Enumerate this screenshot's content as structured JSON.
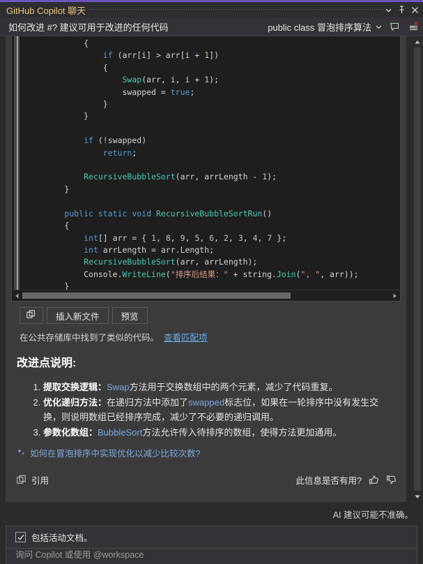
{
  "window": {
    "title": "GitHub Copilot 聊天",
    "accent_color": "#6a55bd",
    "title_color": "#e8c77b",
    "dropdown_icon": "chevron-down-icon",
    "pin_icon": "pin-icon",
    "close_icon": "close-icon"
  },
  "header": {
    "prompt": "如何改进 #? 建议可用于改进的任何代码",
    "context": "public class 冒泡排序算法",
    "context_dropdown_icon": "chevron-down-icon",
    "new_chat_icon": "new-chat-icon",
    "clear_chat_icon": "clear-chat-icon"
  },
  "code_block": {
    "language": "csharp",
    "lines": [
      {
        "indent": 12,
        "tokens": [
          {
            "t": "{",
            "c": "p"
          }
        ]
      },
      {
        "indent": 16,
        "tokens": [
          {
            "t": "if",
            "c": "k"
          },
          {
            "t": " (arr[i] > arr[i + ",
            "c": "p"
          },
          {
            "t": "1",
            "c": "n"
          },
          {
            "t": "])",
            "c": "p"
          }
        ]
      },
      {
        "indent": 16,
        "tokens": [
          {
            "t": "{",
            "c": "p"
          }
        ]
      },
      {
        "indent": 20,
        "tokens": [
          {
            "t": "Swap",
            "c": "m"
          },
          {
            "t": "(arr, i, i + ",
            "c": "p"
          },
          {
            "t": "1",
            "c": "n"
          },
          {
            "t": ");",
            "c": "p"
          }
        ]
      },
      {
        "indent": 20,
        "tokens": [
          {
            "t": "swapped = ",
            "c": "p"
          },
          {
            "t": "true",
            "c": "k"
          },
          {
            "t": ";",
            "c": "p"
          }
        ]
      },
      {
        "indent": 16,
        "tokens": [
          {
            "t": "}",
            "c": "p"
          }
        ]
      },
      {
        "indent": 12,
        "tokens": [
          {
            "t": "}",
            "c": "p"
          }
        ]
      },
      {
        "indent": 0,
        "tokens": []
      },
      {
        "indent": 12,
        "tokens": [
          {
            "t": "if",
            "c": "k"
          },
          {
            "t": " (!swapped)",
            "c": "p"
          }
        ]
      },
      {
        "indent": 16,
        "tokens": [
          {
            "t": "return",
            "c": "k"
          },
          {
            "t": ";",
            "c": "p"
          }
        ]
      },
      {
        "indent": 0,
        "tokens": []
      },
      {
        "indent": 12,
        "tokens": [
          {
            "t": "RecursiveBubbleSort",
            "c": "m"
          },
          {
            "t": "(arr, arrLength - ",
            "c": "p"
          },
          {
            "t": "1",
            "c": "n"
          },
          {
            "t": ");",
            "c": "p"
          }
        ]
      },
      {
        "indent": 8,
        "tokens": [
          {
            "t": "}",
            "c": "p"
          }
        ]
      },
      {
        "indent": 0,
        "tokens": []
      },
      {
        "indent": 8,
        "tokens": [
          {
            "t": "public",
            "c": "k"
          },
          {
            "t": " ",
            "c": "p"
          },
          {
            "t": "static",
            "c": "k"
          },
          {
            "t": " ",
            "c": "p"
          },
          {
            "t": "void",
            "c": "k"
          },
          {
            "t": " ",
            "c": "p"
          },
          {
            "t": "RecursiveBubbleSortRun",
            "c": "m"
          },
          {
            "t": "()",
            "c": "p"
          }
        ]
      },
      {
        "indent": 8,
        "tokens": [
          {
            "t": "{",
            "c": "p"
          }
        ]
      },
      {
        "indent": 12,
        "tokens": [
          {
            "t": "int",
            "c": "k"
          },
          {
            "t": "[] arr = { ",
            "c": "p"
          },
          {
            "t": "1",
            "c": "n"
          },
          {
            "t": ", ",
            "c": "p"
          },
          {
            "t": "8",
            "c": "n"
          },
          {
            "t": ", ",
            "c": "p"
          },
          {
            "t": "9",
            "c": "n"
          },
          {
            "t": ", ",
            "c": "p"
          },
          {
            "t": "5",
            "c": "n"
          },
          {
            "t": ", ",
            "c": "p"
          },
          {
            "t": "6",
            "c": "n"
          },
          {
            "t": ", ",
            "c": "p"
          },
          {
            "t": "2",
            "c": "n"
          },
          {
            "t": ", ",
            "c": "p"
          },
          {
            "t": "3",
            "c": "n"
          },
          {
            "t": ", ",
            "c": "p"
          },
          {
            "t": "4",
            "c": "n"
          },
          {
            "t": ", ",
            "c": "p"
          },
          {
            "t": "7",
            "c": "n"
          },
          {
            "t": " };",
            "c": "p"
          }
        ]
      },
      {
        "indent": 12,
        "tokens": [
          {
            "t": "int",
            "c": "k"
          },
          {
            "t": " arrLength = arr.Length;",
            "c": "p"
          }
        ]
      },
      {
        "indent": 12,
        "tokens": [
          {
            "t": "RecursiveBubbleSort",
            "c": "m"
          },
          {
            "t": "(arr, arrLength);",
            "c": "p"
          }
        ]
      },
      {
        "indent": 12,
        "tokens": [
          {
            "t": "Console.",
            "c": "p"
          },
          {
            "t": "WriteLine",
            "c": "m"
          },
          {
            "t": "(",
            "c": "p"
          },
          {
            "t": "\"排序后结果：\"",
            "c": "s"
          },
          {
            "t": " + string.",
            "c": "p"
          },
          {
            "t": "Join",
            "c": "m"
          },
          {
            "t": "(",
            "c": "p"
          },
          {
            "t": "\", \"",
            "c": "s"
          },
          {
            "t": ", arr));",
            "c": "p"
          }
        ]
      },
      {
        "indent": 8,
        "tokens": [
          {
            "t": "}",
            "c": "p"
          }
        ]
      },
      {
        "indent": 4,
        "tokens": [
          {
            "t": "}",
            "c": "p"
          }
        ]
      },
      {
        "indent": 0,
        "tokens": [
          {
            "t": "}",
            "c": "p"
          }
        ]
      }
    ]
  },
  "actions": {
    "copy_icon": "copy-icon",
    "insert_label": "插入新文件",
    "preview_label": "预览"
  },
  "repo_note": {
    "text": "在公共存储库中找到了类似的代码。",
    "link_label": "查看匹配项",
    "link_color": "#6aa9e0"
  },
  "explanation": {
    "title": "改进点说明:",
    "items": [
      {
        "num": "1.",
        "bold": "提取交换逻辑：",
        "parts": [
          {
            "text": "Swap",
            "style": "code"
          },
          {
            "text": "方法用于交换数组中的两个元素，减少了代码重复。",
            "style": "plain"
          }
        ]
      },
      {
        "num": "2.",
        "bold": "优化递归方法：",
        "parts": [
          {
            "text": "在递归方法中添加了",
            "style": "plain"
          },
          {
            "text": "swapped",
            "style": "code"
          },
          {
            "text": "标志位，如果在一轮排序中没有发生交换，则说明数组已经排序完成，减少了不必要的递归调用。",
            "style": "plain"
          }
        ]
      },
      {
        "num": "3.",
        "bold": "参数化数组：",
        "parts": [
          {
            "text": "BubbleSort",
            "style": "code"
          },
          {
            "text": "方法允许传入待排序的数组，使得方法更加通用。",
            "style": "plain"
          }
        ]
      }
    ]
  },
  "followup": {
    "icon": "sparkle-icon",
    "label": "如何在冒泡排序中实现优化以减少比较次数?",
    "color": "#7fa9dd"
  },
  "message_footer": {
    "cite_icon": "citation-icon",
    "cite_label": "引用",
    "feedback_question": "此信息是否有用?",
    "thumbs_up_icon": "thumbs-up-icon",
    "thumbs_down_icon": "thumbs-down-icon"
  },
  "disclaimer": {
    "text": "AI 建议可能不准确。"
  },
  "composer": {
    "checkbox_checked": true,
    "checkbox_label": "包括活动文档。",
    "placeholder": "询问 Copilot 或使用 @workspace"
  }
}
